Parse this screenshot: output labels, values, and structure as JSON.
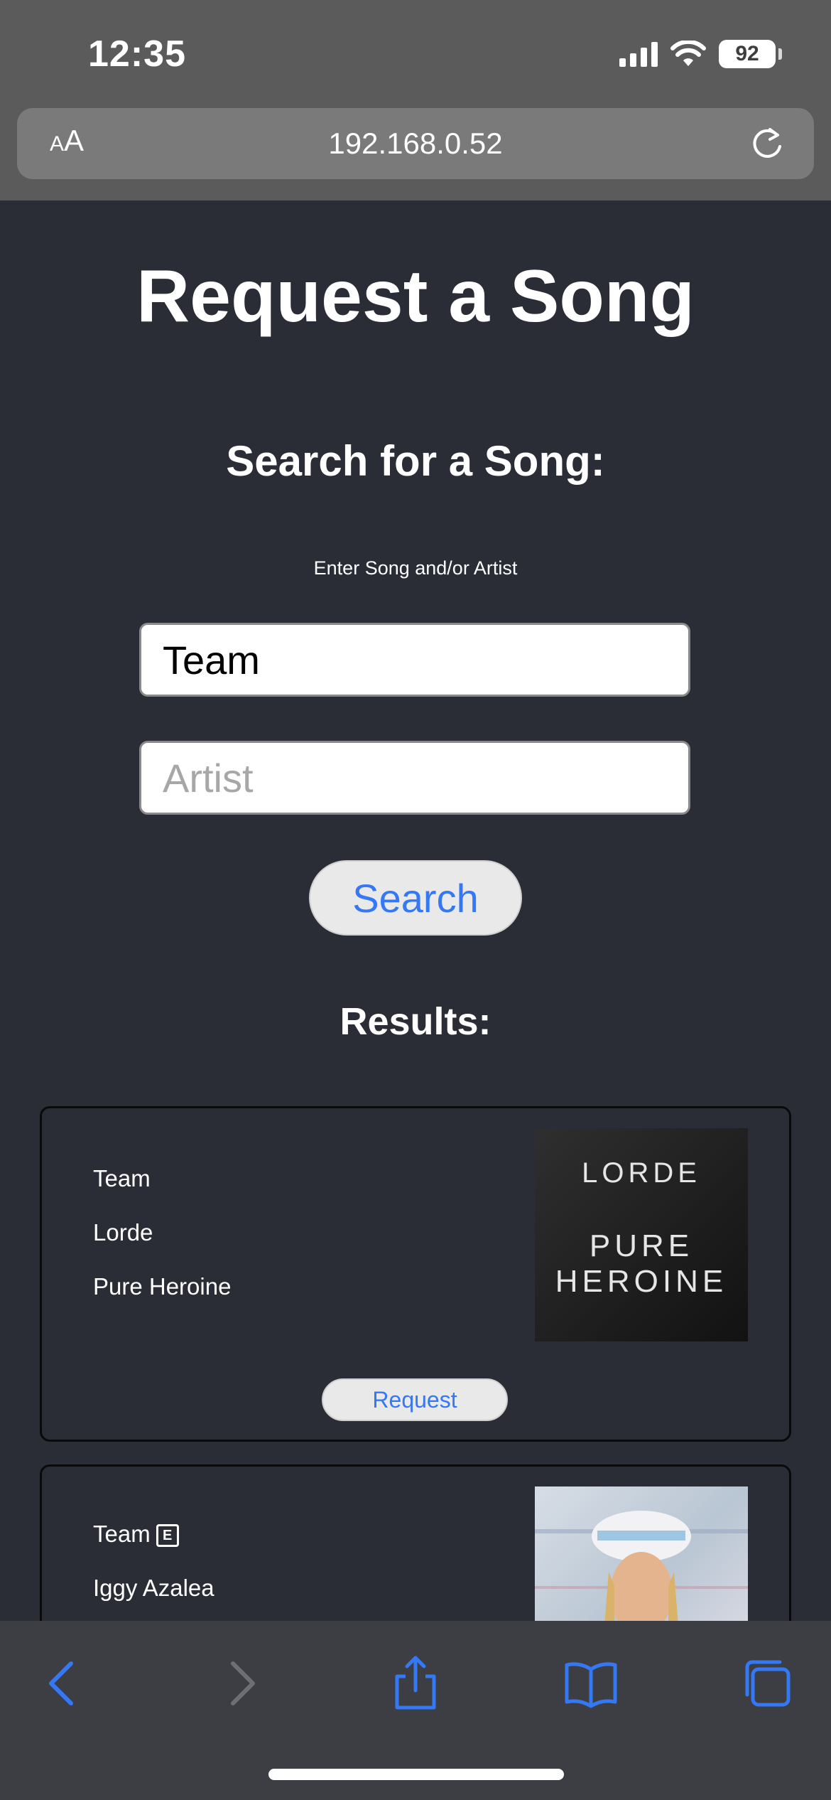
{
  "status_bar": {
    "time": "12:35",
    "battery": "92"
  },
  "browser": {
    "url": "192.168.0.52",
    "text_size_label_small": "A",
    "text_size_label_large": "A"
  },
  "page": {
    "title": "Request a Song",
    "search_heading": "Search for a Song:",
    "search_hint": "Enter Song and/or Artist",
    "song_input_value": "Team",
    "artist_input_placeholder": "Artist",
    "search_button": "Search",
    "results_heading": "Results:"
  },
  "results": [
    {
      "song": "Team",
      "artist": "Lorde",
      "album": "Pure Heroine",
      "explicit": false,
      "art_text_top": "LORDE",
      "art_text_line2": "PURE",
      "art_text_line3": "HEROINE",
      "request_label": "Request"
    },
    {
      "song": "Team",
      "artist": "Iggy Azalea",
      "explicit": true,
      "explicit_label": "E"
    }
  ],
  "colors": {
    "background": "#2a2d35",
    "accent": "#3478f6",
    "chrome": "#5b5b5b",
    "toolbar": "#3d3e43"
  }
}
